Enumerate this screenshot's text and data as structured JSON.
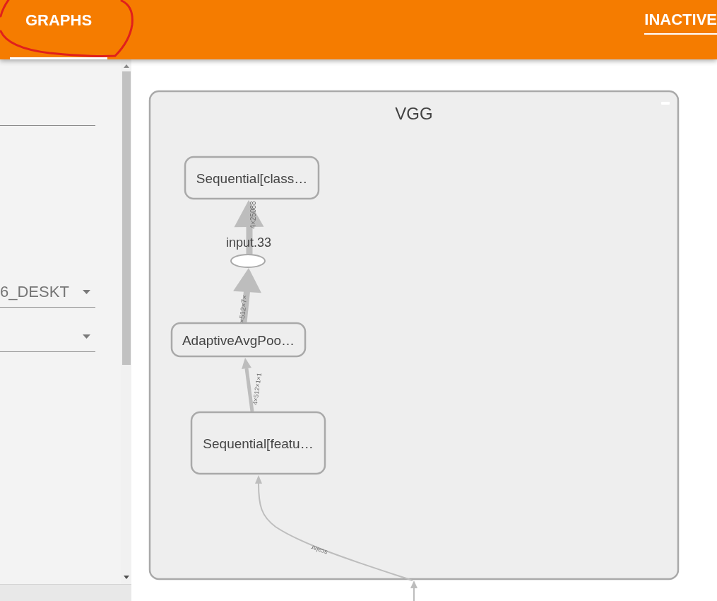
{
  "header": {
    "tabs": [
      {
        "label": "GRAPHS",
        "selected": true
      }
    ],
    "inactive_menu": {
      "label": "INACTIVE"
    }
  },
  "annotations": [
    {
      "kind": "circle"
    }
  ],
  "sidebar": {
    "fields": [
      {
        "kind": "input"
      },
      {
        "kind": "dropdown",
        "value": "6_DESKT"
      },
      {
        "kind": "dropdown"
      }
    ]
  },
  "graph": {
    "title": "VGG",
    "expanded": true,
    "nodes": [
      {
        "kind": "op",
        "label": "Sequential[class…"
      },
      {
        "kind": "tensor",
        "label": "input.33"
      },
      {
        "kind": "op",
        "label": "AdaptiveAvgPoo…"
      },
      {
        "kind": "op",
        "label": "Sequential[featu…"
      }
    ],
    "edges": [
      {
        "kind": "thick",
        "label": "4×25088"
      },
      {
        "kind": "thick",
        "label": "×512×7×"
      },
      {
        "kind": "medium",
        "label": "4×512×1×1"
      },
      {
        "kind": "thin",
        "label": "scalar"
      },
      {
        "kind": "thin"
      }
    ]
  }
}
